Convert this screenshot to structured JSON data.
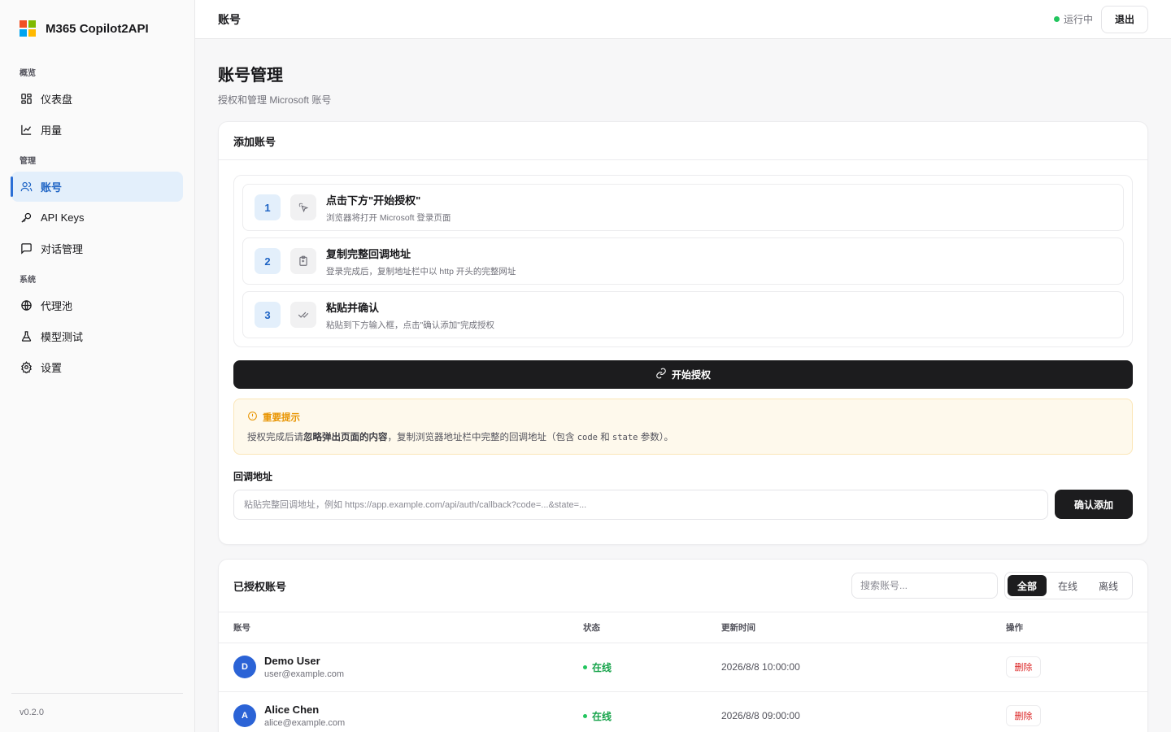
{
  "brand": {
    "name": "M365 Copilot2API",
    "logo_colors": [
      "#f25022",
      "#7fba00",
      "#00a4ef",
      "#ffb900"
    ]
  },
  "sidebar": {
    "groups": [
      {
        "label": "概览",
        "items": [
          {
            "label": "仪表盘",
            "icon": "dashboard-icon"
          },
          {
            "label": "用量",
            "icon": "chart-line-icon"
          }
        ]
      },
      {
        "label": "管理",
        "items": [
          {
            "label": "账号",
            "icon": "users-icon"
          },
          {
            "label": "API Keys",
            "icon": "key-icon"
          },
          {
            "label": "对话管理",
            "icon": "message-square-icon"
          }
        ]
      },
      {
        "label": "系统",
        "items": [
          {
            "label": "代理池",
            "icon": "globe-icon"
          },
          {
            "label": "模型测试",
            "icon": "flask-icon"
          },
          {
            "label": "设置",
            "icon": "gear-icon"
          }
        ]
      }
    ],
    "active_item": "账号",
    "version": "v0.2.0"
  },
  "topbar": {
    "title": "账号",
    "status": "运行中",
    "logout_label": "退出"
  },
  "page": {
    "title": "账号管理",
    "subtitle": "授权和管理 Microsoft 账号"
  },
  "add_account": {
    "title": "添加账号",
    "steps": [
      {
        "num": "1",
        "title": "点击下方\"开始授权\"",
        "desc": "浏览器将打开 Microsoft 登录页面",
        "icon": "pointer-click-icon"
      },
      {
        "num": "2",
        "title": "复制完整回调地址",
        "desc": "登录完成后，复制地址栏中以 http 开头的完整网址",
        "icon": "clipboard-icon"
      },
      {
        "num": "3",
        "title": "粘贴并确认",
        "desc": "粘贴到下方输入框，点击\"确认添加\"完成授权",
        "icon": "check-double-icon"
      }
    ],
    "auth_button": "开始授权",
    "notice": {
      "title": "重要提示",
      "text_before": "授权完成后请",
      "text_bold": "忽略弹出页面的内容",
      "text_mid": "，复制浏览器地址栏中完整的回调地址（包含 ",
      "code1": "code",
      "text_and": " 和 ",
      "code2": "state",
      "text_after": " 参数）。"
    },
    "callback_label": "回调地址",
    "callback_placeholder": "粘贴完整回调地址，例如 https://app.example.com/api/auth/callback?code=...&state=...",
    "confirm_button": "确认添加"
  },
  "accounts": {
    "title": "已授权账号",
    "search_placeholder": "搜索账号...",
    "filters": [
      "全部",
      "在线",
      "离线"
    ],
    "active_filter": "全部",
    "columns": [
      "账号",
      "状态",
      "更新时间",
      "操作"
    ],
    "rows": [
      {
        "initial": "D",
        "name": "Demo User",
        "email": "user@example.com",
        "status": "在线",
        "updated": "2026/8/8 10:00:00",
        "action": "删除"
      },
      {
        "initial": "A",
        "name": "Alice Chen",
        "email": "alice@example.com",
        "status": "在线",
        "updated": "2026/8/8 09:00:00",
        "action": "删除"
      }
    ]
  }
}
